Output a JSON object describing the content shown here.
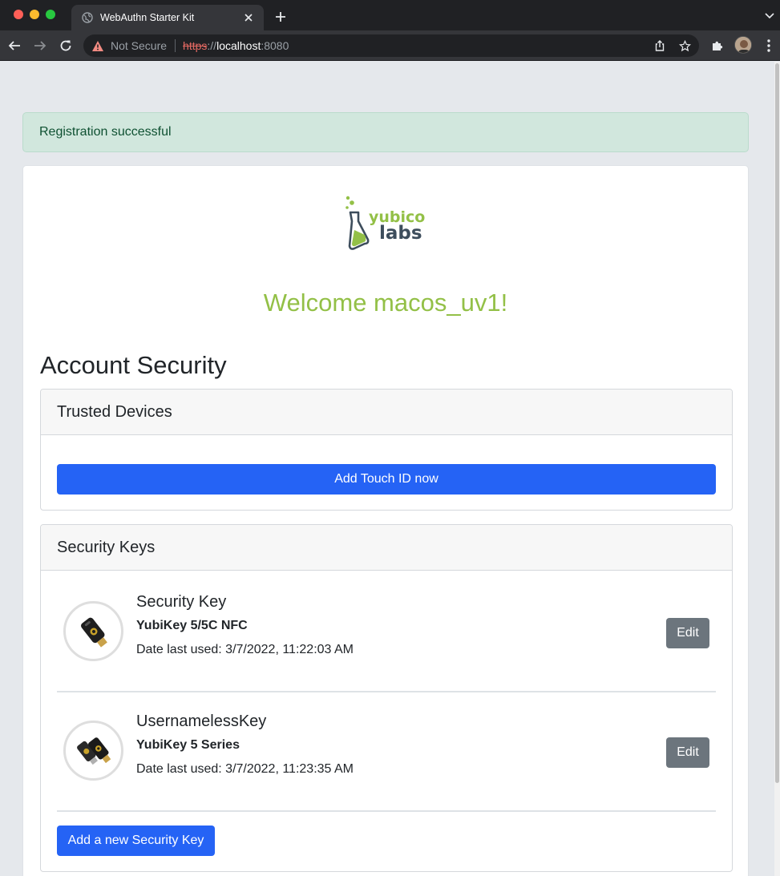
{
  "browser": {
    "tab_title": "WebAuthn Starter Kit",
    "security_label": "Not Secure",
    "url_scheme": "https",
    "url_separator": "://",
    "url_host": "localhost",
    "url_port": ":8080"
  },
  "alert": {
    "message": "Registration successful",
    "color": "#d1e7dd"
  },
  "logo": {
    "line1": "yubico",
    "line2": "labs"
  },
  "welcome": "Welcome macos_uv1!",
  "page_title": "Account Security",
  "trusted_devices": {
    "title": "Trusted Devices",
    "button": "Add Touch ID now"
  },
  "security_keys": {
    "title": "Security Keys",
    "items": [
      {
        "name": "Security Key",
        "model": "YubiKey 5/5C NFC",
        "date_last_used": "Date last used: 3/7/2022, 11:22:03 AM",
        "edit_label": "Edit",
        "icon": "yubikey-5c-nfc-icon"
      },
      {
        "name": "UsernamelessKey",
        "model": "YubiKey 5 Series",
        "date_last_used": "Date last used: 3/7/2022, 11:23:35 AM",
        "edit_label": "Edit",
        "icon": "yubikey-5-series-icon"
      }
    ],
    "add_button": "Add a new Security Key"
  },
  "colors": {
    "primary": "#2563f5",
    "welcome_green": "#93c047",
    "edit_gray": "#6c757d"
  }
}
